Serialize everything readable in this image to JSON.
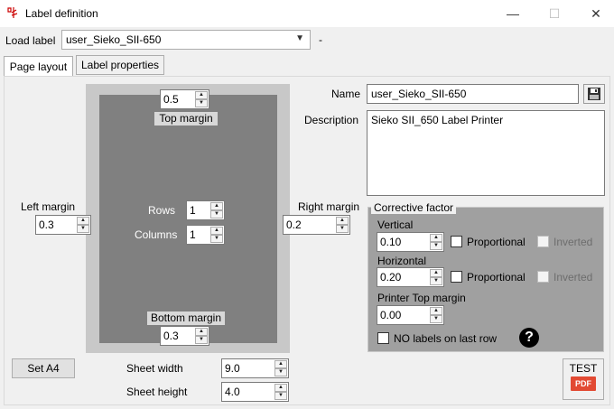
{
  "window": {
    "title": "Label definition",
    "controls": {
      "minimize": "—",
      "maximize": "☐",
      "close": "✕"
    }
  },
  "load": {
    "label": "Load label",
    "selected": "user_Sieko_SII-650",
    "dash": "-"
  },
  "tabs": [
    {
      "label": "Page layout",
      "active": true
    },
    {
      "label": "Label properties",
      "active": false
    }
  ],
  "layout": {
    "top_margin": {
      "label": "Top margin",
      "value": "0.5"
    },
    "bottom_margin": {
      "label": "Bottom margin",
      "value": "0.3"
    },
    "left_margin": {
      "label": "Left margin",
      "value": "0.3"
    },
    "right_margin": {
      "label": "Right margin",
      "value": "0.2"
    },
    "rows": {
      "label": "Rows",
      "value": "1"
    },
    "columns": {
      "label": "Columns",
      "value": "1"
    },
    "set_a4": "Set A4",
    "sheet_width": {
      "label": "Sheet width",
      "value": "9.0"
    },
    "sheet_height": {
      "label": "Sheet height",
      "value": "4.0"
    }
  },
  "details": {
    "name_label": "Name",
    "name_value": "user_Sieko_SII-650",
    "description_label": "Description",
    "description_value": "Sieko SII_650 Label Printer"
  },
  "corrective": {
    "title": "Corrective factor",
    "vertical": {
      "label": "Vertical",
      "value": "0.10",
      "proportional": "Proportional",
      "inverted": "Inverted"
    },
    "horizontal": {
      "label": "Horizontal",
      "value": "0.20",
      "proportional": "Proportional",
      "inverted": "Inverted"
    },
    "printer_top": {
      "label": "Printer Top margin",
      "value": "0.00"
    },
    "no_labels_last_row": "NO labels on last row",
    "help": "?"
  },
  "test_button": {
    "label": "TEST",
    "badge": "PDF"
  },
  "colors": {
    "paper_outer": "#c8c8c8",
    "paper_inner": "#808080",
    "group_bg": "#a0a0a0",
    "pdf_red": "#e24a33"
  }
}
